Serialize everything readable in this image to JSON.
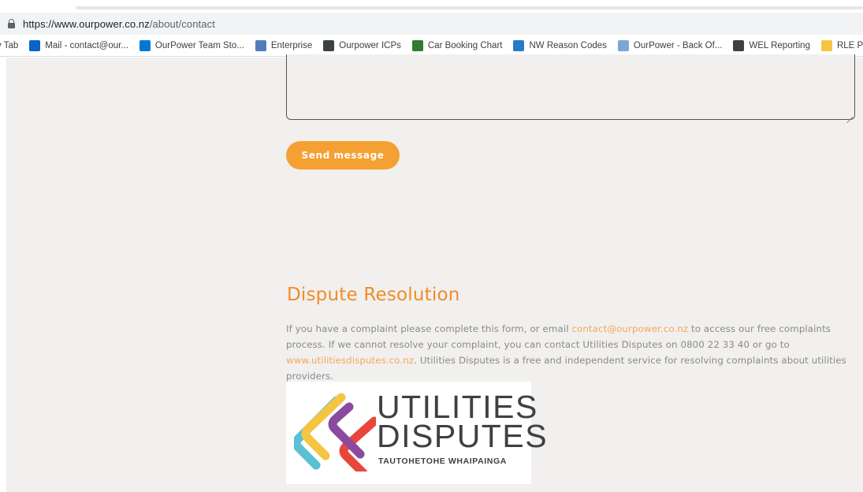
{
  "browser": {
    "url_host": "https://www.ourpower.co.nz",
    "url_path": "/about/contact",
    "bookmarks": [
      {
        "label": "v Tab",
        "icon": "new-tab-icon",
        "color": ""
      },
      {
        "label": "Mail - contact@our...",
        "icon": "outlook-icon",
        "color": "#0a64c8"
      },
      {
        "label": "OurPower Team Sto...",
        "icon": "azure-devops-icon",
        "color": "#0078d4"
      },
      {
        "label": "Enterprise",
        "icon": "enterprise-icon",
        "color": "#4f7fb8"
      },
      {
        "label": "Ourpower ICPs",
        "icon": "globe-icon",
        "color": "#3c4043"
      },
      {
        "label": "Car Booking Chart",
        "icon": "sheet-icon",
        "color": "#2e7d32"
      },
      {
        "label": "NW Reason Codes",
        "icon": "feather-icon",
        "color": "#2979c9"
      },
      {
        "label": "OurPower - Back Of...",
        "icon": "doc-icon",
        "color": "#7aa7d8"
      },
      {
        "label": "WEL Reporting",
        "icon": "report-icon",
        "color": "#3c4043"
      },
      {
        "label": "RLE Presentation",
        "icon": "folder-icon",
        "color": "#f5c542"
      }
    ]
  },
  "form": {
    "send_label": "Send message"
  },
  "dispute": {
    "heading": "Dispute Resolution",
    "text_1": "If you have a complaint please complete this form, or email ",
    "email_link": "contact@ourpower.co.nz",
    "text_2": " to access our free complaints process. If we cannot resolve your complaint, you can contact Utilities Disputes on 0800 22 33 40 or go to ",
    "site_link": "www.utilitiesdisputes.co.nz",
    "text_3": ". Utilities Disputes is a free and independent service for resolving complaints about utilities providers."
  },
  "logo": {
    "line1": "UTILITIES",
    "line2": "DISPUTES",
    "subtitle": "TAUTOHETOHE WHAIPAINGA",
    "colors": [
      "#5bbfd6",
      "#f5c542",
      "#e8463a",
      "#8b4aa0"
    ]
  }
}
